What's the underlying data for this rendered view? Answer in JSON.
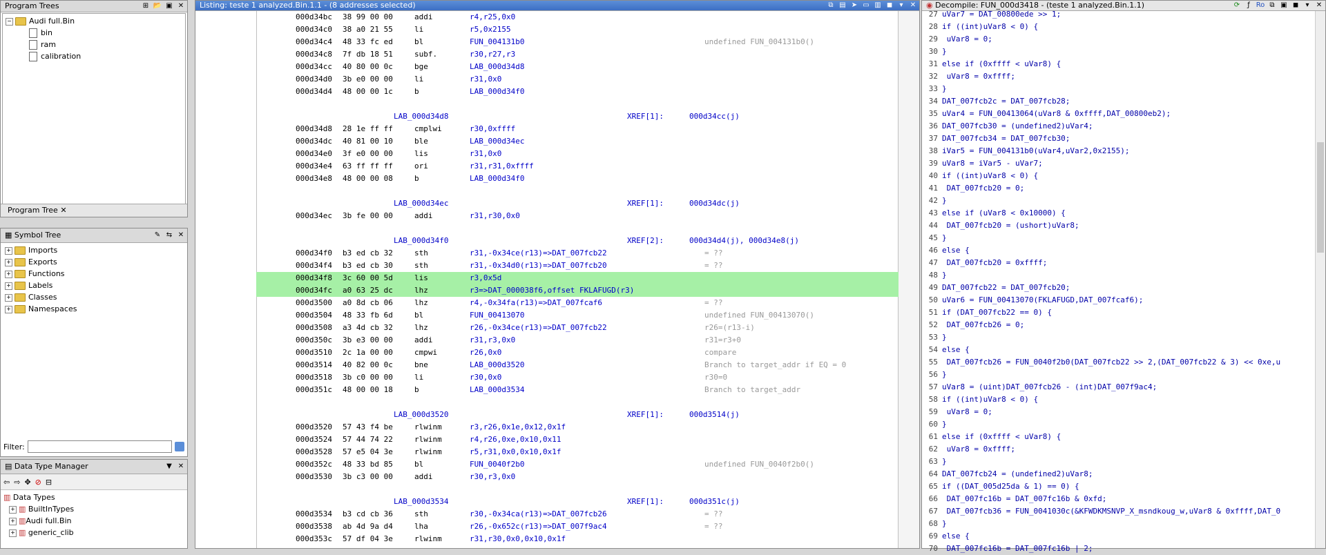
{
  "program_trees": {
    "title": "Program Trees",
    "root": "Audi full.Bin",
    "children": [
      "bin",
      "ram",
      "calibration"
    ],
    "tab": "Program Tree"
  },
  "symbol_tree": {
    "title": "Symbol Tree",
    "items": [
      "Imports",
      "Exports",
      "Functions",
      "Labels",
      "Classes",
      "Namespaces"
    ]
  },
  "filter": {
    "label": "Filter:",
    "value": ""
  },
  "data_type_manager": {
    "title": "Data Type Manager",
    "root": "Data Types",
    "items": [
      "BuiltInTypes",
      "Audi full.Bin",
      "generic_clib"
    ]
  },
  "listing": {
    "title": "Listing:  teste 1 analyzed.Bin.1.1 - (8 addresses selected)",
    "lines": [
      {
        "addr": "000d34bc",
        "bytes": "38 99 00 00",
        "mn": "addi",
        "op": "r4,r25,0x0",
        "cm": ""
      },
      {
        "addr": "000d34c0",
        "bytes": "38 a0 21 55",
        "mn": "li",
        "op": "r5,0x2155",
        "cm": ""
      },
      {
        "addr": "000d34c4",
        "bytes": "48 33 fc ed",
        "mn": "bl",
        "op": "FUN_004131b0",
        "cm": "undefined FUN_004131b0()"
      },
      {
        "addr": "000d34c8",
        "bytes": "7f db 18 51",
        "mn": "subf.",
        "op": "r30,r27,r3",
        "cm": ""
      },
      {
        "addr": "000d34cc",
        "bytes": "40 80 00 0c",
        "mn": "bge",
        "op": "LAB_000d34d8",
        "cm": ""
      },
      {
        "addr": "000d34d0",
        "bytes": "3b e0 00 00",
        "mn": "li",
        "op": "r31,0x0",
        "cm": ""
      },
      {
        "addr": "000d34d4",
        "bytes": "48 00 00 1c",
        "mn": "b",
        "op": "LAB_000d34f0",
        "cm": ""
      },
      {
        "label": "LAB_000d34d8",
        "xref": "XREF[1]:",
        "xv": "000d34cc(j)"
      },
      {
        "addr": "000d34d8",
        "bytes": "28 1e ff ff",
        "mn": "cmplwi",
        "op": "r30,0xffff",
        "cm": ""
      },
      {
        "addr": "000d34dc",
        "bytes": "40 81 00 10",
        "mn": "ble",
        "op": "LAB_000d34ec",
        "cm": ""
      },
      {
        "addr": "000d34e0",
        "bytes": "3f e0 00 00",
        "mn": "lis",
        "op": "r31,0x0",
        "cm": ""
      },
      {
        "addr": "000d34e4",
        "bytes": "63 ff ff ff",
        "mn": "ori",
        "op": "r31,r31,0xffff",
        "cm": ""
      },
      {
        "addr": "000d34e8",
        "bytes": "48 00 00 08",
        "mn": "b",
        "op": "LAB_000d34f0",
        "cm": ""
      },
      {
        "label": "LAB_000d34ec",
        "xref": "XREF[1]:",
        "xv": "000d34dc(j)"
      },
      {
        "addr": "000d34ec",
        "bytes": "3b fe 00 00",
        "mn": "addi",
        "op": "r31,r30,0x0",
        "cm": ""
      },
      {
        "label": "LAB_000d34f0",
        "xref": "XREF[2]:",
        "xv": "000d34d4(j), 000d34e8(j)"
      },
      {
        "addr": "000d34f0",
        "bytes": "b3 ed cb 32",
        "mn": "sth",
        "op": "r31,-0x34ce(r13)=>DAT_007fcb22",
        "cm": "= ??"
      },
      {
        "addr": "000d34f4",
        "bytes": "b3 ed cb 30",
        "mn": "sth",
        "op": "r31,-0x34d0(r13)=>DAT_007fcb20",
        "cm": "= ??"
      },
      {
        "addr": "000d34f8",
        "bytes": "3c 60 00 5d",
        "mn": "lis",
        "op": "r3,0x5d",
        "cm": "",
        "hl": true
      },
      {
        "addr": "000d34fc",
        "bytes": "a0 63 25 dc",
        "mn": "lhz",
        "op": "r3=>DAT_000038f6,offset FKLAFUGD(r3)",
        "cm": "",
        "hl": true
      },
      {
        "addr": "000d3500",
        "bytes": "a0 8d cb 06",
        "mn": "lhz",
        "op": "r4,-0x34fa(r13)=>DAT_007fcaf6",
        "cm": "= ??"
      },
      {
        "addr": "000d3504",
        "bytes": "48 33 fb 6d",
        "mn": "bl",
        "op": "FUN_00413070",
        "cm": "undefined FUN_00413070()"
      },
      {
        "addr": "000d3508",
        "bytes": "a3 4d cb 32",
        "mn": "lhz",
        "op": "r26,-0x34ce(r13)=>DAT_007fcb22",
        "cm": "r26=(r13-i)"
      },
      {
        "addr": "000d350c",
        "bytes": "3b e3 00 00",
        "mn": "addi",
        "op": "r31,r3,0x0",
        "cm": "r31=r3+0"
      },
      {
        "addr": "000d3510",
        "bytes": "2c 1a 00 00",
        "mn": "cmpwi",
        "op": "r26,0x0",
        "cm": "compare"
      },
      {
        "addr": "000d3514",
        "bytes": "40 82 00 0c",
        "mn": "bne",
        "op": "LAB_000d3520",
        "cm": "Branch to target_addr if EQ = 0"
      },
      {
        "addr": "000d3518",
        "bytes": "3b c0 00 00",
        "mn": "li",
        "op": "r30,0x0",
        "cm": "r30=0"
      },
      {
        "addr": "000d351c",
        "bytes": "48 00 00 18",
        "mn": "b",
        "op": "LAB_000d3534",
        "cm": "Branch to target_addr"
      },
      {
        "label": "LAB_000d3520",
        "xref": "XREF[1]:",
        "xv": "000d3514(j)"
      },
      {
        "addr": "000d3520",
        "bytes": "57 43 f4 be",
        "mn": "rlwinm",
        "op": "r3,r26,0x1e,0x12,0x1f",
        "cm": ""
      },
      {
        "addr": "000d3524",
        "bytes": "57 44 74 22",
        "mn": "rlwinm",
        "op": "r4,r26,0xe,0x10,0x11",
        "cm": ""
      },
      {
        "addr": "000d3528",
        "bytes": "57 e5 04 3e",
        "mn": "rlwinm",
        "op": "r5,r31,0x0,0x10,0x1f",
        "cm": ""
      },
      {
        "addr": "000d352c",
        "bytes": "48 33 bd 85",
        "mn": "bl",
        "op": "FUN_0040f2b0",
        "cm": "undefined FUN_0040f2b0()"
      },
      {
        "addr": "000d3530",
        "bytes": "3b c3 00 00",
        "mn": "addi",
        "op": "r30,r3,0x0",
        "cm": ""
      },
      {
        "label": "LAB_000d3534",
        "xref": "XREF[1]:",
        "xv": "000d351c(j)"
      },
      {
        "addr": "000d3534",
        "bytes": "b3 cd cb 36",
        "mn": "sth",
        "op": "r30,-0x34ca(r13)=>DAT_007fcb26",
        "cm": "= ??"
      },
      {
        "addr": "000d3538",
        "bytes": "ab 4d 9a d4",
        "mn": "lha",
        "op": "r26,-0x652c(r13)=>DAT_007f9ac4",
        "cm": "= ??"
      },
      {
        "addr": "000d353c",
        "bytes": "57 df 04 3e",
        "mn": "rlwinm",
        "op": "r31,r30,0x0,0x10,0x1f",
        "cm": ""
      }
    ]
  },
  "decompile": {
    "title": "Decompile: FUN_000d3418 -  (teste 1 analyzed.Bin.1.1)",
    "lines": [
      {
        "n": "27",
        "t": "uVar7 = DAT_00800ede >> 1;"
      },
      {
        "n": "28",
        "t": "if ((int)uVar8 < 0) {"
      },
      {
        "n": "29",
        "t": "  uVar8 = 0;"
      },
      {
        "n": "30",
        "t": "}"
      },
      {
        "n": "31",
        "t": "else if (0xffff < uVar8) {"
      },
      {
        "n": "32",
        "t": "  uVar8 = 0xffff;"
      },
      {
        "n": "33",
        "t": "}"
      },
      {
        "n": "34",
        "t": "DAT_007fcb2c = DAT_007fcb28;"
      },
      {
        "n": "35",
        "t": "uVar4 = FUN_00413064(uVar8 & 0xffff,DAT_00800eb2);"
      },
      {
        "n": "36",
        "t": "DAT_007fcb30 = (undefined2)uVar4;"
      },
      {
        "n": "37",
        "t": "DAT_007fcb34 = DAT_007fcb30;"
      },
      {
        "n": "38",
        "t": "iVar5 = FUN_004131b0(uVar4,uVar2,0x2155);"
      },
      {
        "n": "39",
        "t": "uVar8 = iVar5 - uVar7;"
      },
      {
        "n": "40",
        "t": "if ((int)uVar8 < 0) {"
      },
      {
        "n": "41",
        "t": "  DAT_007fcb20 = 0;"
      },
      {
        "n": "42",
        "t": "}"
      },
      {
        "n": "43",
        "t": "else if (uVar8 < 0x10000) {"
      },
      {
        "n": "44",
        "t": "  DAT_007fcb20 = (ushort)uVar8;"
      },
      {
        "n": "45",
        "t": "}"
      },
      {
        "n": "46",
        "t": "else {"
      },
      {
        "n": "47",
        "t": "  DAT_007fcb20 = 0xffff;"
      },
      {
        "n": "48",
        "t": "}"
      },
      {
        "n": "49",
        "t": "DAT_007fcb22 = DAT_007fcb20;"
      },
      {
        "n": "50",
        "t": "uVar6 = FUN_00413070(FKLAFUGD,DAT_007fcaf6);"
      },
      {
        "n": "51",
        "t": "if (DAT_007fcb22 == 0) {"
      },
      {
        "n": "52",
        "t": "  DAT_007fcb26 = 0;"
      },
      {
        "n": "53",
        "t": "}"
      },
      {
        "n": "54",
        "t": "else {"
      },
      {
        "n": "55",
        "t": "  DAT_007fcb26 = FUN_0040f2b0(DAT_007fcb22 >> 2,(DAT_007fcb22 & 3) << 0xe,u"
      },
      {
        "n": "56",
        "t": "}"
      },
      {
        "n": "57",
        "t": "uVar8 = (uint)DAT_007fcb26 - (int)DAT_007f9ac4;"
      },
      {
        "n": "58",
        "t": "if ((int)uVar8 < 0) {"
      },
      {
        "n": "59",
        "t": "  uVar8 = 0;"
      },
      {
        "n": "60",
        "t": "}"
      },
      {
        "n": "61",
        "t": "else if (0xffff < uVar8) {"
      },
      {
        "n": "62",
        "t": "  uVar8 = 0xffff;"
      },
      {
        "n": "63",
        "t": "}"
      },
      {
        "n": "64",
        "t": "DAT_007fcb24 = (undefined2)uVar8;"
      },
      {
        "n": "65",
        "t": "if ((DAT_005d25da & 1) == 0) {"
      },
      {
        "n": "66",
        "t": "  DAT_007fc16b = DAT_007fc16b & 0xfd;"
      },
      {
        "n": "67",
        "t": "  DAT_007fcb36 = FUN_0041030c(&KFWDKMSNVP_X_msndkoug_w,uVar8 & 0xffff,DAT_0"
      },
      {
        "n": "68",
        "t": "}"
      },
      {
        "n": "69",
        "t": "else {"
      },
      {
        "n": "70",
        "t": "  DAT_007fc16b = DAT_007fc16b | 2;"
      }
    ]
  },
  "icons": {
    "close": "close-icon",
    "gear": "gear-icon",
    "home": "home-icon",
    "save": "save-icon"
  }
}
